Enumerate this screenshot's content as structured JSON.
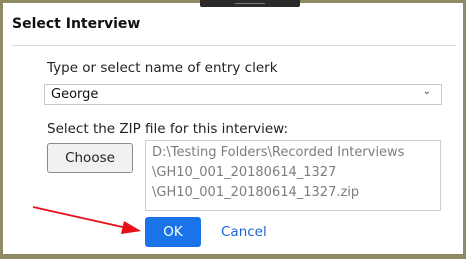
{
  "dialog": {
    "title": "Select Interview",
    "clerk_label": "Type or select name of entry clerk",
    "clerk_value": "George",
    "zip_label": "Select the ZIP file for this interview:",
    "choose_label": "Choose",
    "zip_path_lines": [
      "D:\\Testing Folders\\Recorded Interviews",
      "\\GH10_001_20180614_1327",
      "\\GH10_001_20180614_1327.zip"
    ],
    "ok_label": "OK",
    "cancel_label": "Cancel"
  },
  "colors": {
    "border": "#8f8a64",
    "ok_button": "#1a73e8",
    "cancel_link": "#1a66d6",
    "annotation_arrow": "#e8101a"
  },
  "icons": {
    "dropdown": "chevron-down-icon",
    "annotation": "red-arrow-icon"
  }
}
